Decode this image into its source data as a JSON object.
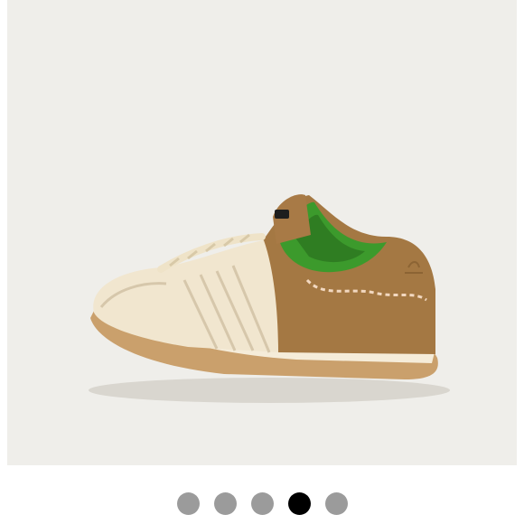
{
  "gallery": {
    "image": {
      "subject": "sneaker-product-photo",
      "colors": {
        "background": "#efeeea",
        "upper_cream": "#f1e6cf",
        "heel_tan": "#a47843",
        "lining_green": "#3c9a2c",
        "sole_gum": "#c9a06c"
      }
    },
    "pagination": {
      "total": 5,
      "active_index": 3,
      "dot_color": "#9b9b9b",
      "active_color": "#000000"
    }
  }
}
